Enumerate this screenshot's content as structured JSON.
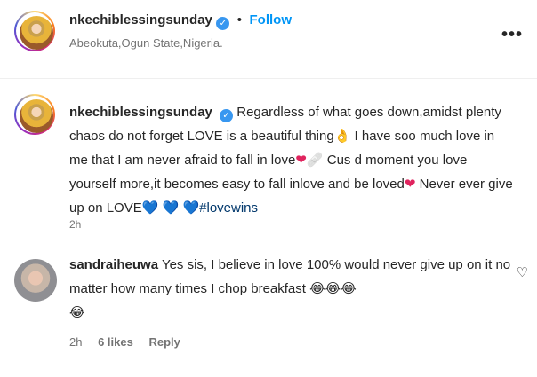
{
  "header": {
    "username": "nkechiblessingsunday",
    "separator": "•",
    "follow_label": "Follow",
    "location": "Abeokuta,Ogun State,Nigeria.",
    "more_icon": "ellipsis-icon",
    "more_glyph": "•••"
  },
  "caption": {
    "username": "nkechiblessingsunday",
    "text_1": "Regardless of what goes down,amidst plenty chaos do not forget LOVE is a beautiful thing",
    "emoji_ok": "👌",
    "text_2": " I have soo much love in me that I am never afraid to fall in love",
    "emoji_heart_1": "❤",
    "emoji_bandage": "🩹",
    "text_3": " Cus d moment you love yourself more,it becomes easy to fall inlove and be loved",
    "emoji_heart_2": "❤",
    "text_4": " Never ever give up on LOVE",
    "emoji_blue_hearts": [
      "💙",
      "💙",
      "💙"
    ],
    "hashtag": "#lovewins",
    "timestamp": "2h"
  },
  "comment": {
    "username": "sandraiheuwa",
    "text": "Yes sis, I believe in love 100% would never give up on it no matter how many times I chop breakfast ",
    "emojis": [
      "😂",
      "😂",
      "😂",
      "😂"
    ],
    "timestamp": "2h",
    "likes": "6 likes",
    "reply_label": "Reply",
    "like_icon": "heart-outline-icon",
    "like_glyph": "♡"
  },
  "colors": {
    "accent": "#0095f6",
    "verified": "#3897f0",
    "hashtag": "#00376b",
    "muted": "#737373"
  }
}
